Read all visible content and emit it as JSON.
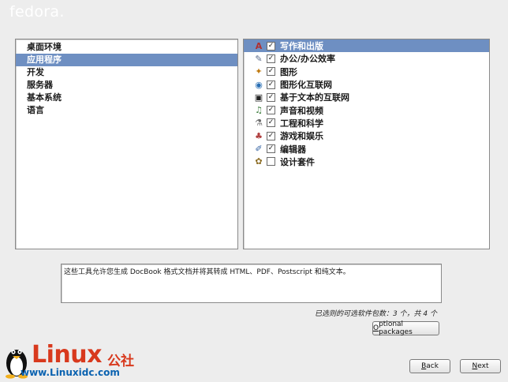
{
  "header": {
    "logo_text": "fedora."
  },
  "groups": {
    "items": [
      {
        "label": "桌面环境",
        "selected": false
      },
      {
        "label": "应用程序",
        "selected": true
      },
      {
        "label": "开发",
        "selected": false
      },
      {
        "label": "服务器",
        "selected": false
      },
      {
        "label": "基本系统",
        "selected": false
      },
      {
        "label": "语言",
        "selected": false
      }
    ]
  },
  "packages": {
    "items": [
      {
        "label": "写作和出版",
        "checked": true,
        "selected": true,
        "icon": "publishing-icon",
        "glyph": "A",
        "color": "#b03030"
      },
      {
        "label": "办公/办公效率",
        "checked": true,
        "selected": false,
        "icon": "office-icon",
        "glyph": "✎",
        "color": "#5a6a8a"
      },
      {
        "label": "图形",
        "checked": true,
        "selected": false,
        "icon": "graphics-icon",
        "glyph": "✦",
        "color": "#c07a10"
      },
      {
        "label": "图形化互联网",
        "checked": true,
        "selected": false,
        "icon": "globe-icon",
        "glyph": "◉",
        "color": "#2a6fb4"
      },
      {
        "label": "基于文本的互联网",
        "checked": true,
        "selected": false,
        "icon": "terminal-icon",
        "glyph": "▣",
        "color": "#222222"
      },
      {
        "label": "声音和视频",
        "checked": true,
        "selected": false,
        "icon": "audio-video-icon",
        "glyph": "♫",
        "color": "#3a7a3a"
      },
      {
        "label": "工程和科学",
        "checked": true,
        "selected": false,
        "icon": "engineering-icon",
        "glyph": "⚗",
        "color": "#6a6a6a"
      },
      {
        "label": "游戏和娱乐",
        "checked": true,
        "selected": false,
        "icon": "games-icon",
        "glyph": "♣",
        "color": "#b04040"
      },
      {
        "label": "编辑器",
        "checked": true,
        "selected": false,
        "icon": "editor-icon",
        "glyph": "✐",
        "color": "#3060a0"
      },
      {
        "label": "设计套件",
        "checked": false,
        "selected": false,
        "icon": "design-suite-icon",
        "glyph": "✿",
        "color": "#8a6a20"
      }
    ]
  },
  "description": "这些工具允许您生成 DocBook 格式文档并将其转成 HTML、PDF、Postscript 和纯文本。",
  "status_text": "已选则的可选软件包数：3 个，共 4 个",
  "buttons": {
    "optional_label_first": "O",
    "optional_label_rest": "ptional packages",
    "back_label_first": "B",
    "back_label_rest": "ack",
    "next_label_first": "N",
    "next_label_rest": "ext"
  },
  "watermark": {
    "brand": "Linux",
    "brand_suffix": "公社",
    "url": "www.Linuxidc.com"
  },
  "colors": {
    "selection": "#6e8fc2",
    "brand_red": "#d8391d",
    "brand_blue": "#0a62b0"
  }
}
